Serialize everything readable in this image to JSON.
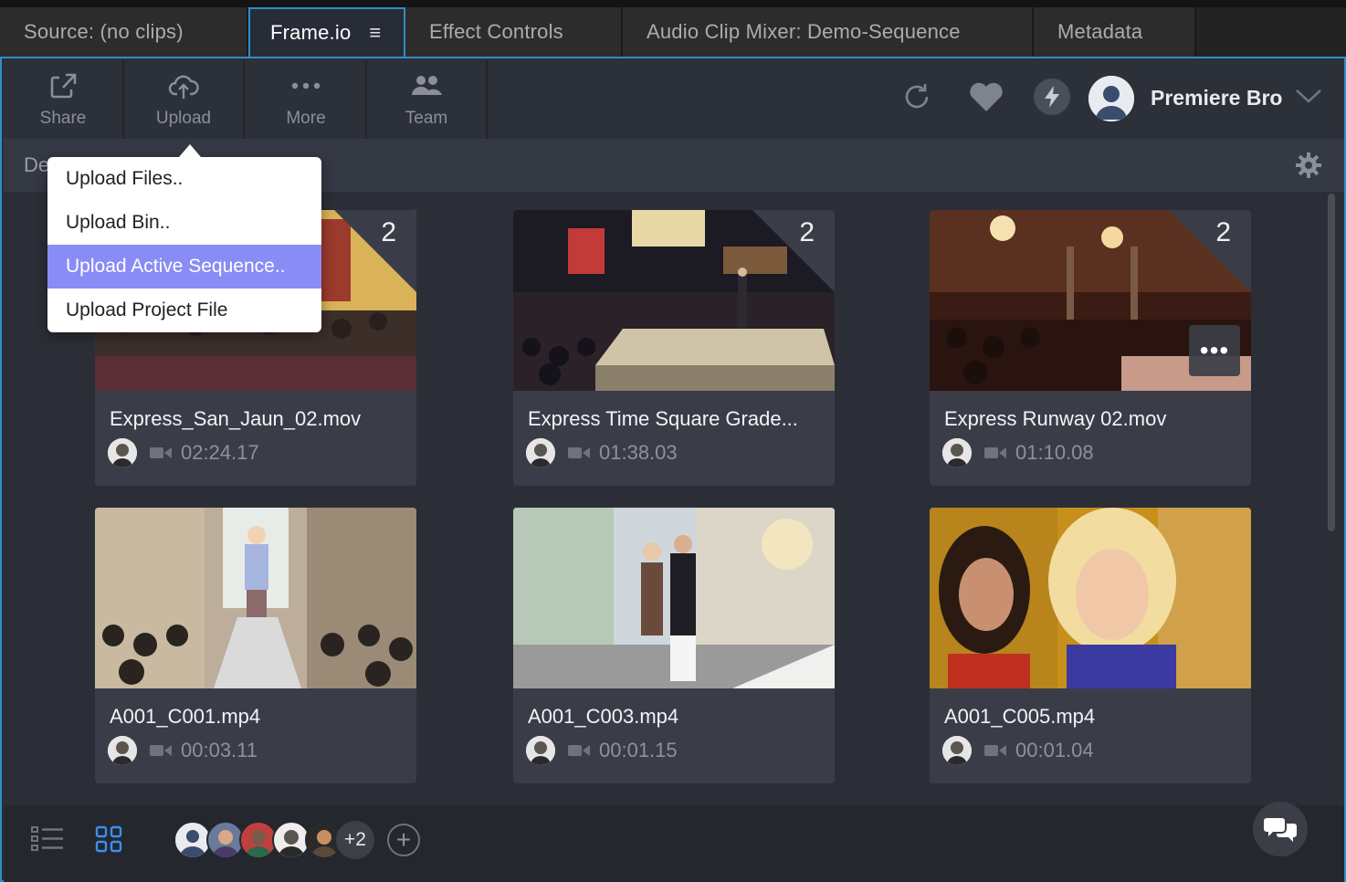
{
  "tabs": [
    {
      "label": "Source: (no clips)"
    },
    {
      "label": "Frame.io",
      "menu_icon": "hamburger-icon"
    },
    {
      "label": "Effect Controls"
    },
    {
      "label": "Audio Clip Mixer: Demo-Sequence"
    },
    {
      "label": "Metadata"
    }
  ],
  "toolbar": {
    "share": "Share",
    "upload": "Upload",
    "more": "More",
    "team": "Team",
    "username": "Premiere Bro",
    "accent": "#2e8ec8"
  },
  "breadcrumb": "De",
  "upload_menu": {
    "items": [
      "Upload Files..",
      "Upload Bin..",
      "Upload Active Sequence..",
      "Upload Project File"
    ],
    "highlighted_index": 2,
    "highlight_color": "#8a8cf5"
  },
  "assets": [
    {
      "title": "Express_San_Jaun_02.mov",
      "duration": "02:24.17",
      "versions": "2"
    },
    {
      "title": "Express Time Square Grade...",
      "duration": "01:38.03",
      "versions": "2"
    },
    {
      "title": "Express Runway 02.mov",
      "duration": "01:10.08",
      "versions": "2"
    },
    {
      "title": "A001_C001.mp4",
      "duration": "00:03.11"
    },
    {
      "title": "A001_C003.mp4",
      "duration": "00:01.15"
    },
    {
      "title": "A001_C005.mp4",
      "duration": "00:01.04"
    }
  ],
  "footer": {
    "extra_collaborators": "+2",
    "add_symbol": "+"
  }
}
